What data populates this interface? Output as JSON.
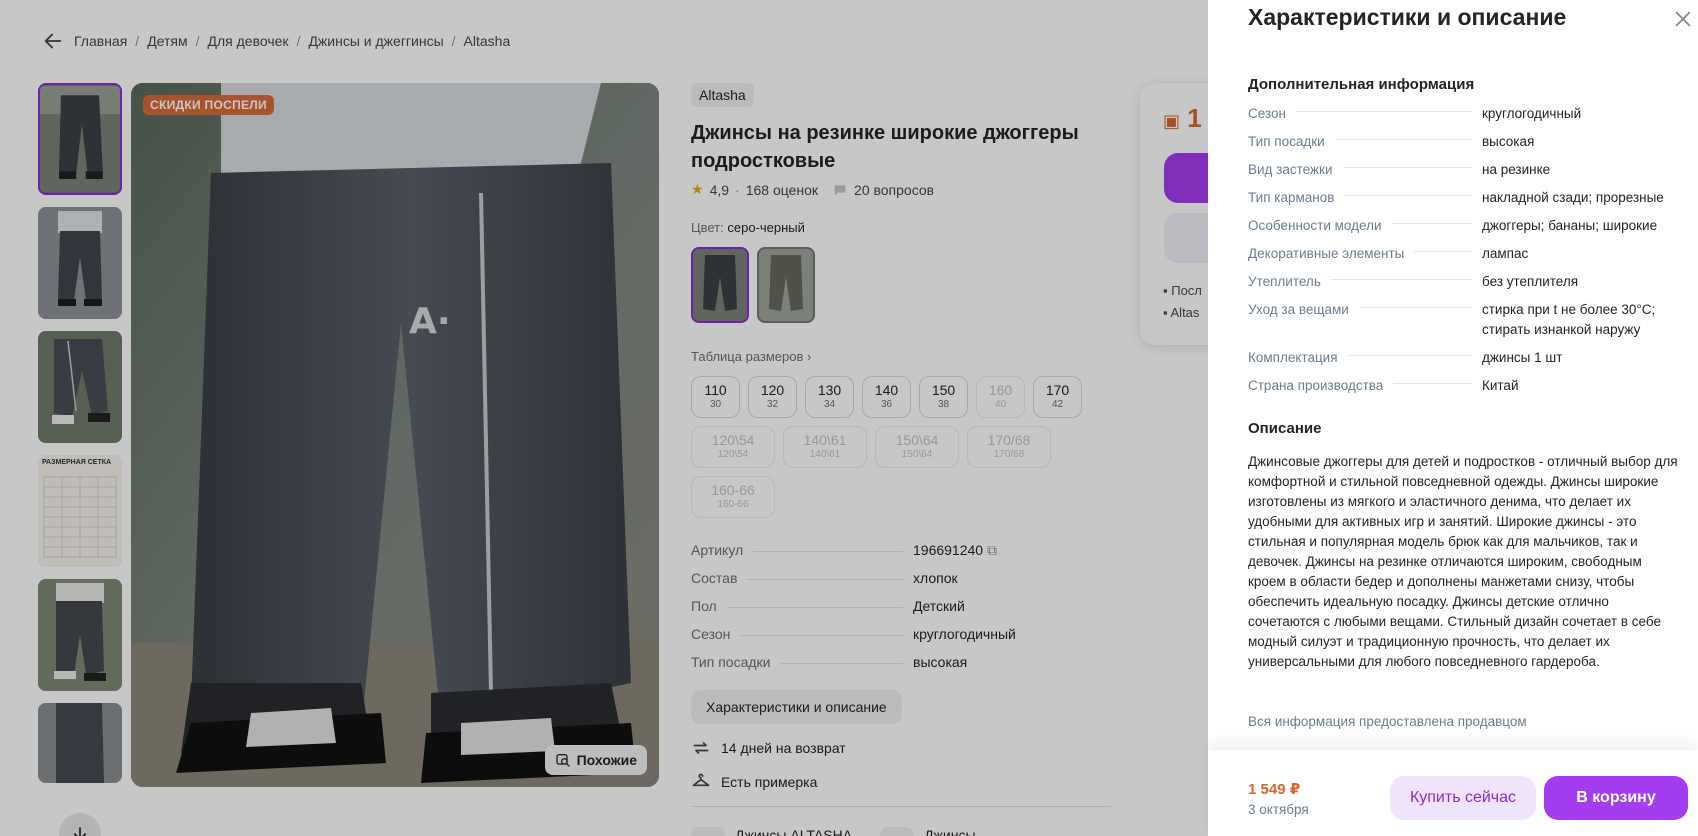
{
  "breadcrumb": {
    "items": [
      "Главная",
      "Детям",
      "Для девочек",
      "Джинсы и джеггинсы",
      "Altasha"
    ]
  },
  "gallery": {
    "promo_badge": "СКИДКИ ПОСПЕЛИ",
    "similar_label": "Похожие",
    "size_chart_thumb_title": "РАЗМЕРНАЯ СЕТКА"
  },
  "product": {
    "brand": "Altasha",
    "title": "Джинсы на резинке широкие джоггеры подростковые",
    "rating": "4,9",
    "reviews": "168 оценок",
    "questions": "20 вопросов",
    "color_label": "Цвет:",
    "color_value": "серо-черный",
    "size_table_label": "Таблица размеров",
    "sizes_row1": [
      {
        "main": "110",
        "sub": "30",
        "disabled": false
      },
      {
        "main": "120",
        "sub": "32",
        "disabled": false
      },
      {
        "main": "130",
        "sub": "34",
        "disabled": false
      },
      {
        "main": "140",
        "sub": "36",
        "disabled": false
      },
      {
        "main": "150",
        "sub": "38",
        "disabled": false
      },
      {
        "main": "160",
        "sub": "40",
        "disabled": true
      },
      {
        "main": "170",
        "sub": "42",
        "disabled": false
      }
    ],
    "sizes_row2": [
      {
        "main": "120\\54",
        "sub": "120\\54",
        "disabled": true
      },
      {
        "main": "140\\61",
        "sub": "140\\61",
        "disabled": true
      },
      {
        "main": "150\\64",
        "sub": "150\\64",
        "disabled": true
      },
      {
        "main": "170/68",
        "sub": "170/68",
        "disabled": true
      },
      {
        "main": "160-66",
        "sub": "160-66",
        "disabled": true
      }
    ],
    "specs": [
      {
        "k": "Артикул",
        "v": "196691240"
      },
      {
        "k": "Состав",
        "v": "хлопок"
      },
      {
        "k": "Пол",
        "v": "Детский"
      },
      {
        "k": "Сезон",
        "v": "круглогодичный"
      },
      {
        "k": "Тип посадки",
        "v": "высокая"
      }
    ],
    "char_button": "Характеристики и описание",
    "return_label": "14 дней на возврат",
    "fitting_label": "Есть примерка",
    "bottom_card1": "Джинсы ALTASHA",
    "bottom_card2": "Джинсы"
  },
  "buy_card": {
    "price_partial": "1",
    "line1": "Посл",
    "line2": "Altas"
  },
  "panel": {
    "title": "Характеристики и описание",
    "extra_title": "Дополнительная информация",
    "attrs": [
      {
        "k": "Сезон",
        "v": "круглогодичный"
      },
      {
        "k": "Тип посадки",
        "v": "высокая"
      },
      {
        "k": "Вид застежки",
        "v": "на резинке"
      },
      {
        "k": "Тип карманов",
        "v": "накладной сзади; прорезные"
      },
      {
        "k": "Особенности модели",
        "v": "джоггеры; бананы; широкие"
      },
      {
        "k": "Декоративные элементы",
        "v": "лампас"
      },
      {
        "k": "Утеплитель",
        "v": "без утеплителя"
      },
      {
        "k": "Уход за вещами",
        "v": "стирка при t не более 30°C; стирать изнанкой наружу"
      },
      {
        "k": "Комплектация",
        "v": "джинсы 1 шт"
      },
      {
        "k": "Страна производства",
        "v": "Китай"
      }
    ],
    "desc_title": "Описание",
    "description": "Джинсовые джоггеры для детей и подростков - отличный выбор для комфортной и стильной повседневной одежды. Джинсы широкие изготовлены из мягкого и эластичного денима, что делает их удобными для активных игр и занятий. Широкие джинсы - это стильная и популярная модель брюк как для мальчиков, так и девочек. Джинсы на резинке отличаются широким, свободным кроем в области бедер и дополнены манжетами снизу, чтобы обеспечить идеальную посадку. Джинсы детские отлично сочетаются с любыми вещами. Стильный дизайн сочетает в себе модный силуэт и традиционную прочность, что делает их универсальными для любого повседневного гардероба.",
    "seller_note": "Вся информация предоставлена продавцом",
    "footer_price": "1 549 ₽",
    "footer_date": "3 октября",
    "buy_now": "Купить сейчас",
    "add_to_cart": "В корзину"
  },
  "colors": {
    "accent": "#a43cf0",
    "price": "#d9662f"
  }
}
